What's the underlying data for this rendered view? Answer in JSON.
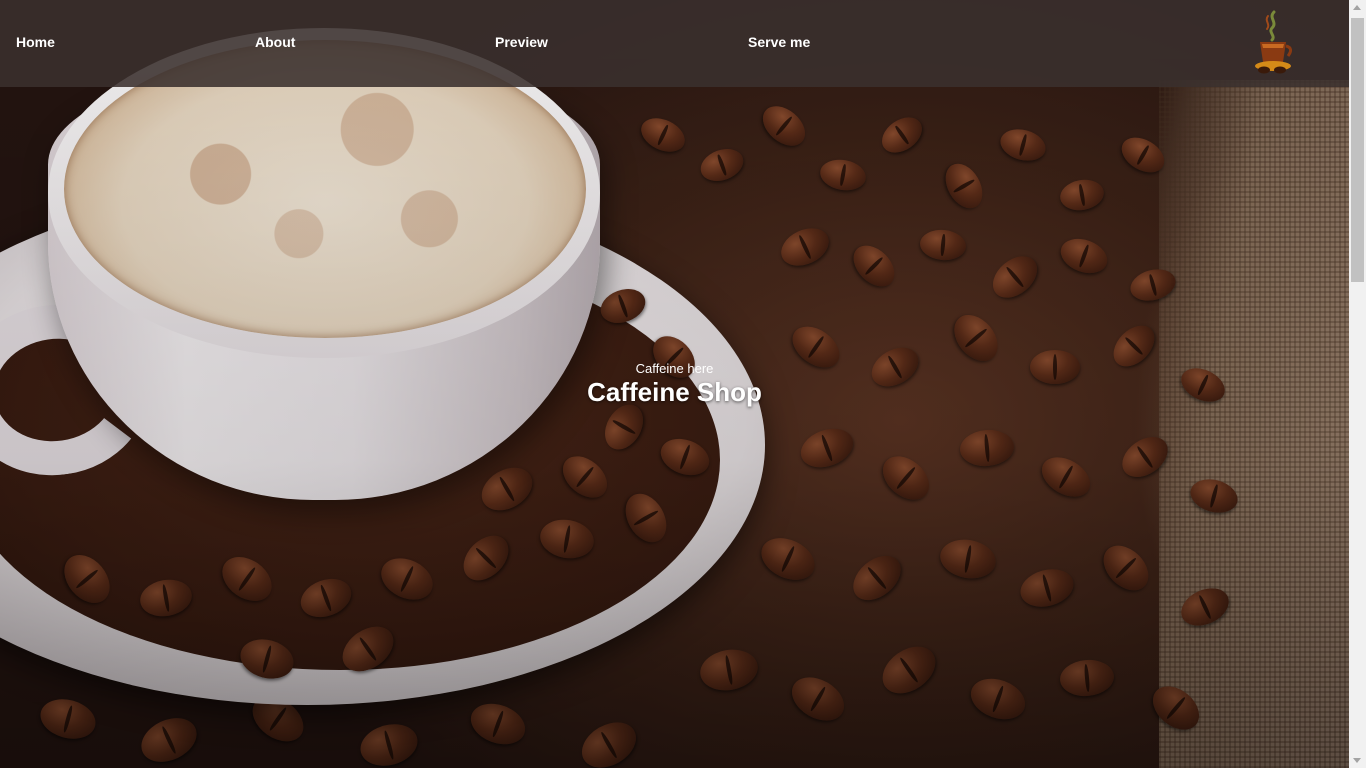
{
  "nav": {
    "items": [
      {
        "label": "Home"
      },
      {
        "label": "About"
      },
      {
        "label": "Preview"
      },
      {
        "label": "Serve me"
      }
    ],
    "logo_icon": "coffee-cup-logo-icon"
  },
  "hero": {
    "subtitle": "Caffeine here",
    "title": "Caffeine Shop",
    "background_image": "coffee cup on saucer with coffee beans"
  },
  "colors": {
    "navbar_bg": "#3a302d",
    "text": "#ffffff",
    "coffee_brown": "#5b2c18"
  }
}
